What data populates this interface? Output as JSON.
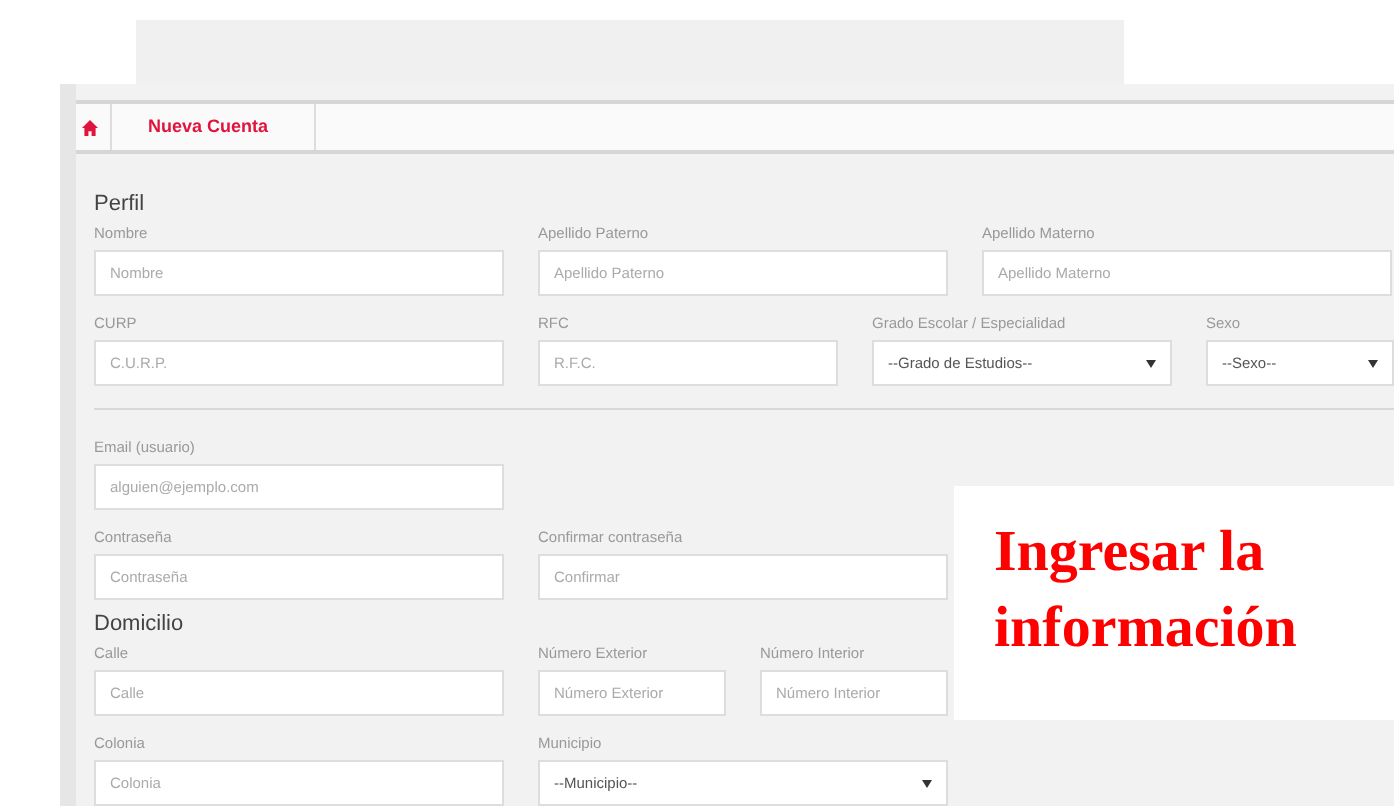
{
  "nav": {
    "tab": "Nueva Cuenta"
  },
  "sections": [
    {
      "title": "Perfil",
      "rows": [
        [
          {
            "kind": "input",
            "label": "Nombre",
            "placeholder": "Nombre"
          },
          {
            "kind": "input",
            "label": "Apellido Paterno",
            "placeholder": "Apellido Paterno"
          },
          {
            "kind": "input",
            "label": "Apellido Materno",
            "placeholder": "Apellido Materno"
          }
        ],
        [
          {
            "kind": "input",
            "label": "CURP",
            "placeholder": "C.U.R.P."
          },
          {
            "kind": "input",
            "label": "RFC",
            "placeholder": "R.F.C."
          },
          {
            "kind": "select",
            "label": "Grado Escolar / Especialidad",
            "value": "--Grado de Estudios--"
          },
          {
            "kind": "select",
            "label": "Sexo",
            "value": "--Sexo--"
          }
        ],
        [
          {
            "kind": "rule"
          }
        ],
        [
          {
            "kind": "input",
            "label": "Email (usuario)",
            "placeholder": "alguien@ejemplo.com"
          }
        ],
        [
          {
            "kind": "input",
            "label": "Contraseña",
            "placeholder": "Contraseña"
          },
          {
            "kind": "input",
            "label": "Confirmar contraseña",
            "placeholder": "Confirmar"
          }
        ]
      ]
    },
    {
      "title": "Domicilio",
      "rows": [
        [
          {
            "kind": "input",
            "label": "Calle",
            "placeholder": "Calle"
          },
          {
            "kind": "input",
            "label": "Número Exterior",
            "placeholder": "Número Exterior"
          },
          {
            "kind": "input",
            "label": "Número Interior",
            "placeholder": "Número Interior"
          }
        ],
        [
          {
            "kind": "input",
            "label": "Colonia",
            "placeholder": "Colonia"
          },
          {
            "kind": "select",
            "label": "Municipio",
            "value": "--Municipio--"
          }
        ]
      ]
    }
  ],
  "callout": {
    "text": "Ingresar la información"
  }
}
